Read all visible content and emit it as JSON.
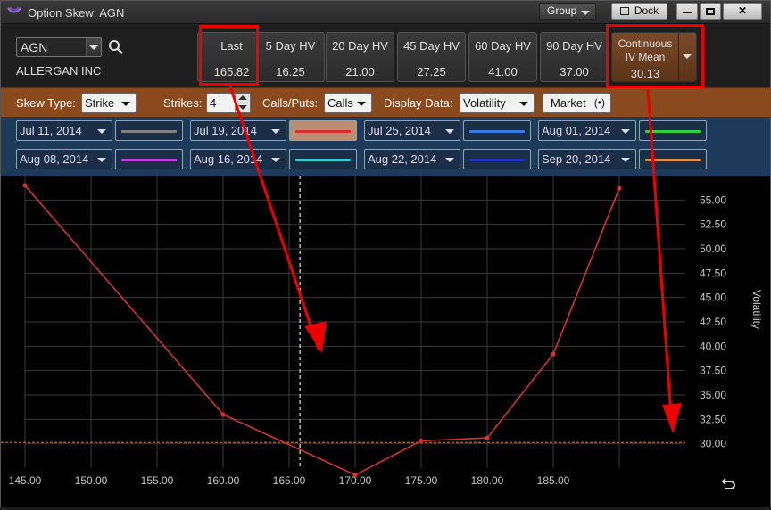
{
  "window": {
    "title": "Option Skew: AGN"
  },
  "titlebar": {
    "group_label": "Group",
    "dock_label": "Dock",
    "minimize_label": "—",
    "maximize_label": "□",
    "close_label": "✕"
  },
  "symbol": {
    "value": "AGN",
    "company": "ALLERGAN INC"
  },
  "stats": [
    {
      "label": "Last",
      "value": "165.82"
    },
    {
      "label": "5 Day HV",
      "value": "16.25"
    },
    {
      "label": "20 Day HV",
      "value": "21.00"
    },
    {
      "label": "45 Day HV",
      "value": "27.25"
    },
    {
      "label": "60 Day HV",
      "value": "41.00"
    },
    {
      "label": "90 Day HV",
      "value": "37.00"
    }
  ],
  "continuous": {
    "label1": "Continuous",
    "label2": "IV Mean",
    "value": "30.13"
  },
  "toolbar": {
    "skew_type_label": "Skew Type:",
    "skew_type_value": "Strike",
    "strikes_label": "Strikes:",
    "strikes_value": "4",
    "callsputs_label": "Calls/Puts:",
    "callsputs_value": "Calls",
    "display_label": "Display Data:",
    "display_value": "Volatility",
    "market_label": "Market"
  },
  "expirations": [
    {
      "date": "Jul 11, 2014",
      "color": "#808080",
      "selected": false
    },
    {
      "date": "Jul 19, 2014",
      "color": "#d83030",
      "selected": true
    },
    {
      "date": "Jul 25, 2014",
      "color": "#3a7ae0",
      "selected": false
    },
    {
      "date": "Aug 01, 2014",
      "color": "#30d040",
      "selected": false
    },
    {
      "date": "Aug 08, 2014",
      "color": "#c040e0",
      "selected": false
    },
    {
      "date": "Aug 16, 2014",
      "color": "#30d0d0",
      "selected": false
    },
    {
      "date": "Aug 22, 2014",
      "color": "#2030c0",
      "selected": false
    },
    {
      "date": "Sep 20, 2014",
      "color": "#e08a40",
      "selected": false
    }
  ],
  "chart_data": {
    "type": "line",
    "ylabel": "Volatility",
    "xlim": [
      145,
      195
    ],
    "ylim": [
      27.5,
      57.5
    ],
    "x_ticks": [
      "145.00",
      "150.00",
      "155.00",
      "160.00",
      "165.00",
      "170.00",
      "175.00",
      "180.00",
      "185.00"
    ],
    "y_ticks": [
      "30.00",
      "32.50",
      "35.00",
      "37.50",
      "40.00",
      "42.50",
      "45.00",
      "47.50",
      "50.00",
      "52.50",
      "55.00"
    ],
    "series": [
      {
        "color": "#d83030",
        "x": [
          145,
          160,
          170,
          175,
          180,
          185,
          190
        ],
        "y": [
          56.5,
          33.0,
          26.8,
          30.3,
          30.6,
          39.2,
          56.2
        ]
      }
    ],
    "last_price_line": 165.82,
    "iv_mean_line": 30.13
  }
}
